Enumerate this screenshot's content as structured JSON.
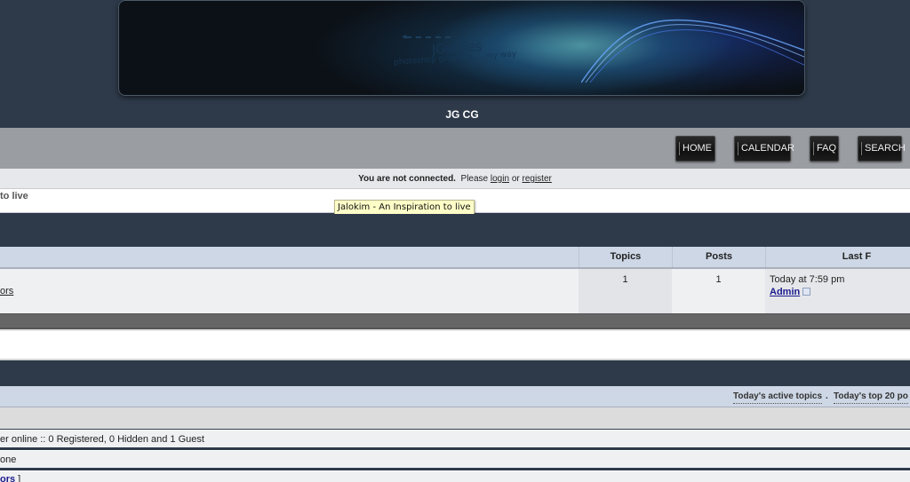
{
  "header": {
    "logo": {
      "title": "JGstyles",
      "subtitle": "photoshop graphics ... my way"
    },
    "site_title": "JG CG"
  },
  "navbar": {
    "items": [
      {
        "label": "HOME"
      },
      {
        "label": "CALENDAR"
      },
      {
        "label": "FAQ"
      },
      {
        "label": "SEARCH"
      }
    ]
  },
  "connection": {
    "status": "You are not connected.",
    "prompt": "Please",
    "login_label": "login",
    "or": "or",
    "register_label": "register"
  },
  "site_description": "to live",
  "tooltip": "Jalokim - An Inspiration to live",
  "forum_table": {
    "columns": {
      "topics": "Topics",
      "posts": "Posts",
      "last_post": "Last F"
    },
    "rows": [
      {
        "name_fragment": "ors",
        "topics": "1",
        "posts": "1",
        "last_post_time": "Today at 7:59 pm",
        "last_post_user": "Admin"
      }
    ]
  },
  "who_is_online": {
    "links": [
      {
        "label": "Today's active topics"
      },
      {
        "label": "Today's top 20 po"
      }
    ],
    "link_separator": ".",
    "users_online": "er online :: 0 Registered, 0 Hidden and 1 Guest",
    "registered_users": "one",
    "legend_link": "ors",
    "legend_suffix": " ]"
  },
  "colors": {
    "page_bg": "#2e3a4a",
    "navbar_bg": "#9a9da2",
    "table_header_bg": "#cdd7e5",
    "link_blue": "#1a1a8c",
    "tooltip_bg": "#ffffc8"
  }
}
